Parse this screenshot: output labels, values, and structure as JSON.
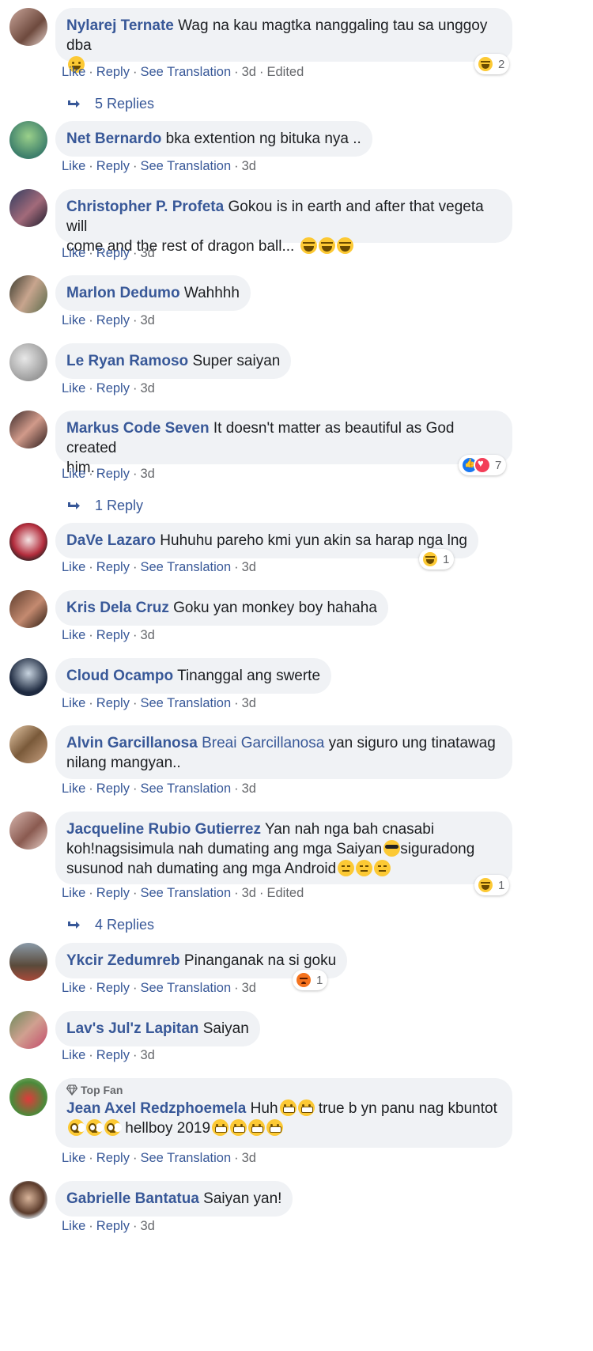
{
  "actions": {
    "like": "Like",
    "reply": "Reply",
    "see_translation": "See Translation",
    "edited": "Edited",
    "dot": "·"
  },
  "colors": {
    "link": "#385898",
    "meta": "#65676b",
    "bubble": "#f0f2f5"
  },
  "comments": [
    {
      "author": "Nylarej Ternate",
      "lines": [
        "Wag na kau magtka nanggaling tau sa unggoy dba"
      ],
      "time": "3d",
      "reaction_count": "2",
      "replies": "5 Replies"
    },
    {
      "author": "Net Bernardo",
      "lines": [
        "bka extention ng bituka nya .."
      ],
      "time": "3d"
    },
    {
      "author": "Christopher P. Profeta",
      "lines": [
        "Gokou is in earth and after that vegeta will",
        "come and the rest of dragon ball..."
      ],
      "time": "3d"
    },
    {
      "author": "Marlon Dedumo",
      "lines": [
        "Wahhhh"
      ],
      "time": "3d"
    },
    {
      "author": "Le Ryan Ramoso",
      "lines": [
        "Super saiyan"
      ],
      "time": "3d"
    },
    {
      "author": "Markus Code Seven",
      "lines": [
        "It doesn't matter as beautiful as God created",
        "him."
      ],
      "time": "3d",
      "reaction_count": "7",
      "replies": "1 Reply"
    },
    {
      "author": "DaVe Lazaro",
      "lines": [
        "Huhuhu pareho kmi yun akin sa harap nga lng"
      ],
      "time": "3d",
      "reaction_count": "1"
    },
    {
      "author": "Kris Dela Cruz",
      "lines": [
        "Goku yan monkey boy hahaha"
      ],
      "time": "3d"
    },
    {
      "author": "Cloud Ocampo",
      "lines": [
        "Tinanggal ang swerte"
      ],
      "time": "3d"
    },
    {
      "author": "Alvin Garcillanosa",
      "mention": "Breai Garcillanosa",
      "lines": [
        "yan siguro ung tinatawag",
        "nilang mangyan.."
      ],
      "time": "3d"
    },
    {
      "author": "Jacqueline Rubio Gutierrez",
      "lines": [
        "Yan nah nga bah cnasabi",
        "koh!nagsisimula nah dumating ang mga Saiyan",
        "siguradong",
        "susunod nah dumating ang mga Android"
      ],
      "time": "3d",
      "reaction_count": "1",
      "replies": "4 Replies"
    },
    {
      "author": "Ykcir Zedumreb",
      "lines": [
        "Pinanganak na si goku"
      ],
      "time": "3d",
      "reaction_count": "1"
    },
    {
      "author": "Lav's Jul'z Lapitan",
      "lines": [
        "Saiyan"
      ],
      "time": "3d"
    },
    {
      "author": "Jean Axel Redzphoemela",
      "badge": "Top Fan",
      "lines": [
        "Huh",
        "true b yn panu nag kbuntot",
        "hellboy 2019"
      ],
      "time": "3d"
    },
    {
      "author": "Gabrielle Bantatua",
      "lines": [
        "Saiyan yan!"
      ],
      "time": "3d"
    }
  ]
}
